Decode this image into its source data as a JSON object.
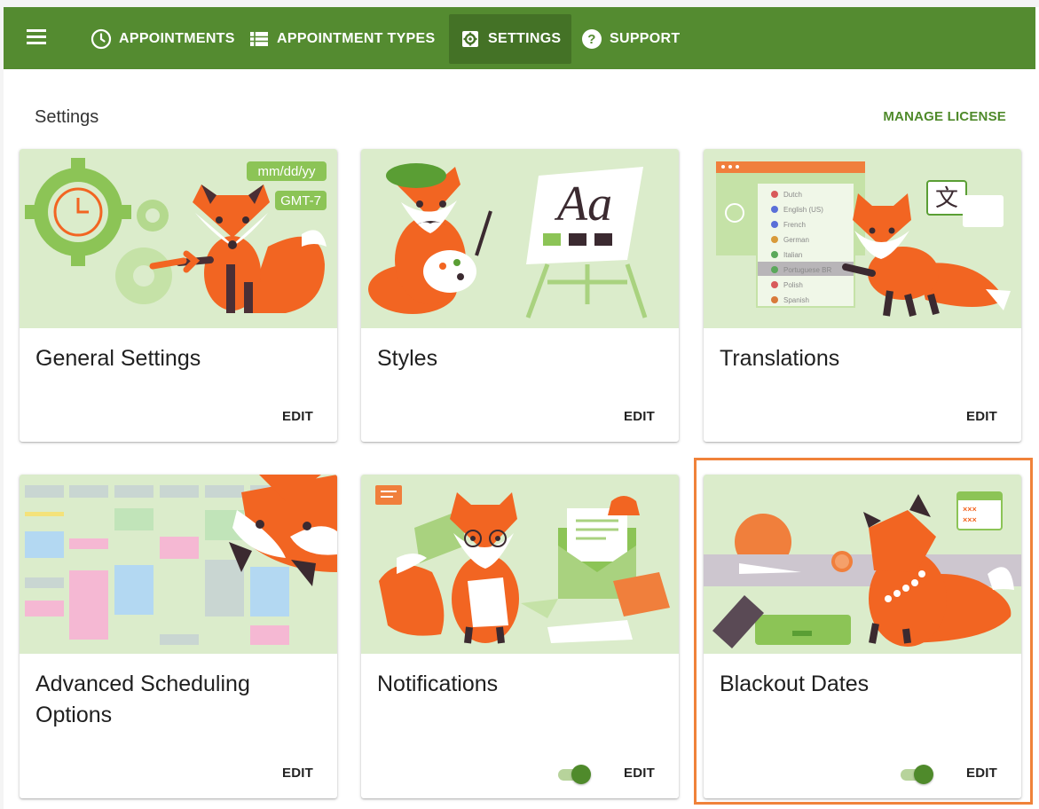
{
  "nav": {
    "items": [
      {
        "label": "APPOINTMENTS",
        "icon": "clock-icon"
      },
      {
        "label": "APPOINTMENT TYPES",
        "icon": "list-icon"
      },
      {
        "label": "SETTINGS",
        "icon": "gear-icon",
        "active": true
      },
      {
        "label": "SUPPORT",
        "icon": "help-icon"
      }
    ]
  },
  "page": {
    "title": "Settings",
    "manage_license": "MANAGE LICENSE"
  },
  "cards": [
    {
      "title": "General Settings",
      "edit": "EDIT",
      "art": {
        "date_format": "mm/dd/yy",
        "timezone": "GMT-7"
      }
    },
    {
      "title": "Styles",
      "edit": "EDIT",
      "art": {
        "sample": "Aa"
      }
    },
    {
      "title": "Translations",
      "edit": "EDIT",
      "art": {
        "languages": [
          "Dutch",
          "English (US)",
          "French",
          "German",
          "Italian",
          "Portuguese BR",
          "Polish",
          "Spanish"
        ],
        "glyph": "文"
      }
    },
    {
      "title": "Advanced Scheduling Options",
      "title_line1": "Advanced Scheduling",
      "title_line2": "Options",
      "edit": "EDIT"
    },
    {
      "title": "Notifications",
      "edit": "EDIT",
      "toggle_on": true
    },
    {
      "title": "Blackout Dates",
      "edit": "EDIT",
      "toggle_on": true,
      "selected": true
    }
  ],
  "colors": {
    "brand_green": "#548b30",
    "accent_orange": "#f0823a",
    "card_art_bg": "#dbeccb",
    "fox_orange": "#f26522"
  }
}
